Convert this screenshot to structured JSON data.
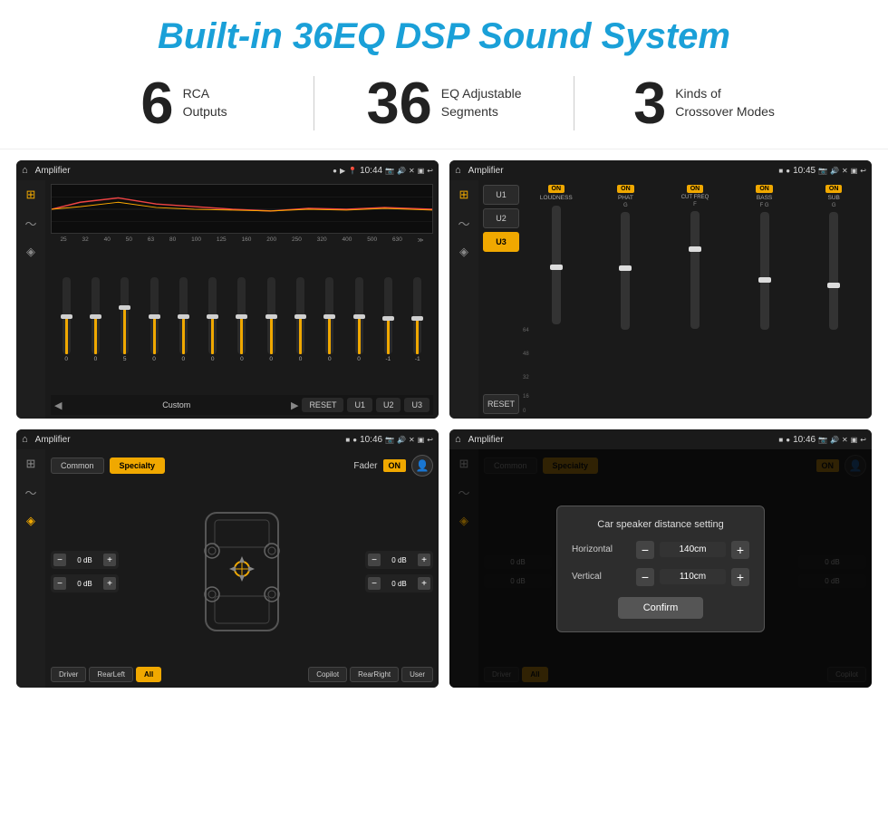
{
  "title": "Built-in 36EQ DSP Sound System",
  "stats": [
    {
      "number": "6",
      "label_line1": "RCA",
      "label_line2": "Outputs"
    },
    {
      "number": "36",
      "label_line1": "EQ Adjustable",
      "label_line2": "Segments"
    },
    {
      "number": "3",
      "label_line1": "Kinds of",
      "label_line2": "Crossover Modes"
    }
  ],
  "screen1": {
    "title": "Amplifier",
    "time": "10:44",
    "eq_freqs": [
      "25",
      "32",
      "40",
      "50",
      "63",
      "80",
      "100",
      "125",
      "160",
      "200",
      "250",
      "320",
      "400",
      "500",
      "630"
    ],
    "eq_values": [
      "0",
      "0",
      "0",
      "5",
      "0",
      "0",
      "0",
      "0",
      "0",
      "0",
      "0",
      "0",
      "0",
      "-1",
      "-1"
    ],
    "controls": [
      "Custom",
      "RESET",
      "U1",
      "U2",
      "U3"
    ]
  },
  "screen2": {
    "title": "Amplifier",
    "time": "10:45",
    "presets": [
      "U1",
      "U2",
      "U3"
    ],
    "channels": [
      "LOUDNESS",
      "PHAT",
      "CUT FREQ",
      "BASS",
      "SUB"
    ]
  },
  "screen3": {
    "title": "Amplifier",
    "time": "10:46",
    "tabs": [
      "Common",
      "Specialty"
    ],
    "fader_label": "Fader",
    "fader_on": "ON",
    "volumes": [
      "0 dB",
      "0 dB",
      "0 dB",
      "0 dB"
    ],
    "buttons": [
      "Driver",
      "RearLeft",
      "All",
      "Copilot",
      "RearRight",
      "User"
    ]
  },
  "screen4": {
    "title": "Amplifier",
    "time": "10:46",
    "tabs": [
      "Common",
      "Specialty"
    ],
    "fader_on": "ON",
    "dialog": {
      "title": "Car speaker distance setting",
      "horizontal_label": "Horizontal",
      "horizontal_value": "140cm",
      "vertical_label": "Vertical",
      "vertical_value": "110cm",
      "confirm_label": "Confirm"
    }
  }
}
